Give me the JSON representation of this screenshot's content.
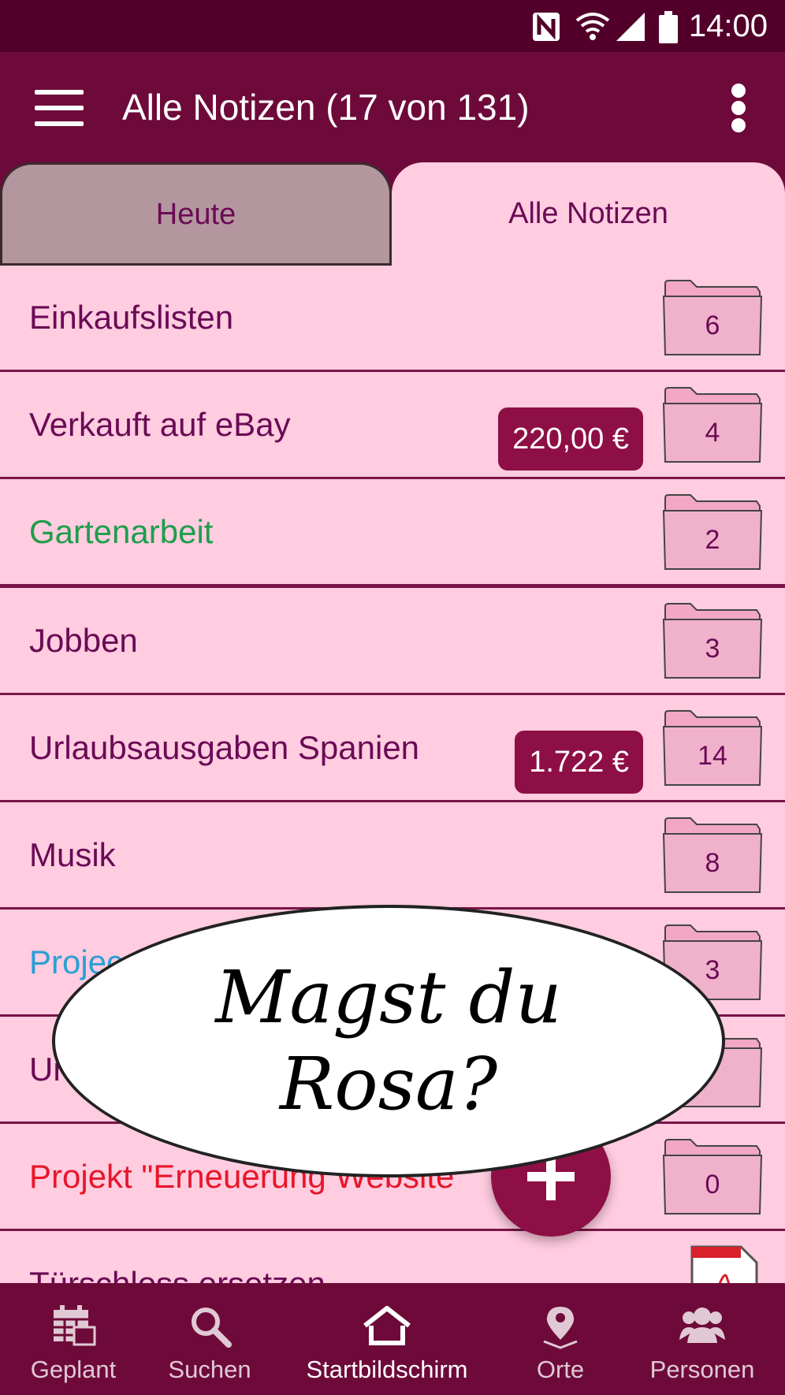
{
  "statusbar": {
    "time": "14:00"
  },
  "appbar": {
    "title": "Alle Notizen (17 von 131)"
  },
  "tabs": [
    {
      "label": "Heute",
      "active": false
    },
    {
      "label": "Alle Notizen",
      "active": true
    }
  ],
  "list": [
    {
      "label": "Einkaufslisten",
      "count": "6",
      "badge": null,
      "color": "#6a0a55"
    },
    {
      "label": "Verkauft auf eBay",
      "count": "4",
      "badge": "220,00 €",
      "color": "#6a0a55"
    },
    {
      "label": "Gartenarbeit",
      "count": "2",
      "badge": null,
      "color": "#1e9e4a"
    },
    {
      "label": "Jobben",
      "count": "3",
      "badge": null,
      "color": "#6a0a55"
    },
    {
      "label": "Urlaubsausgaben Spanien",
      "count": "14",
      "badge": "1.722 €",
      "color": "#6a0a55"
    },
    {
      "label": "Musik",
      "count": "8",
      "badge": null,
      "color": "#6a0a55"
    },
    {
      "label": "Projec",
      "count": "3",
      "badge": null,
      "color": "#2a9fd6"
    },
    {
      "label": "Ur",
      "count": "",
      "badge": null,
      "color": "#6a0a55"
    },
    {
      "label": "Projekt \"Erneuerung Website",
      "count": "0",
      "badge": null,
      "color": "#e8162a"
    },
    {
      "label": "Türschloss ersetzen",
      "count": null,
      "badge": null,
      "color": "#6a0a55",
      "icon": "pdf-icon"
    }
  ],
  "bubble": {
    "text": "Magst du Rosa?"
  },
  "bottomnav": [
    {
      "label": "Geplant",
      "icon": "calendar-icon"
    },
    {
      "label": "Suchen",
      "icon": "search-icon"
    },
    {
      "label": "Startbildschirm",
      "icon": "home-icon",
      "active": true
    },
    {
      "label": "Orte",
      "icon": "location-pin-icon"
    },
    {
      "label": "Personen",
      "icon": "people-icon"
    }
  ],
  "colors": {
    "appbar": "#6e0a3a",
    "statusbar": "#52002a",
    "background": "#ffcce0",
    "accent": "#8e0f46"
  }
}
